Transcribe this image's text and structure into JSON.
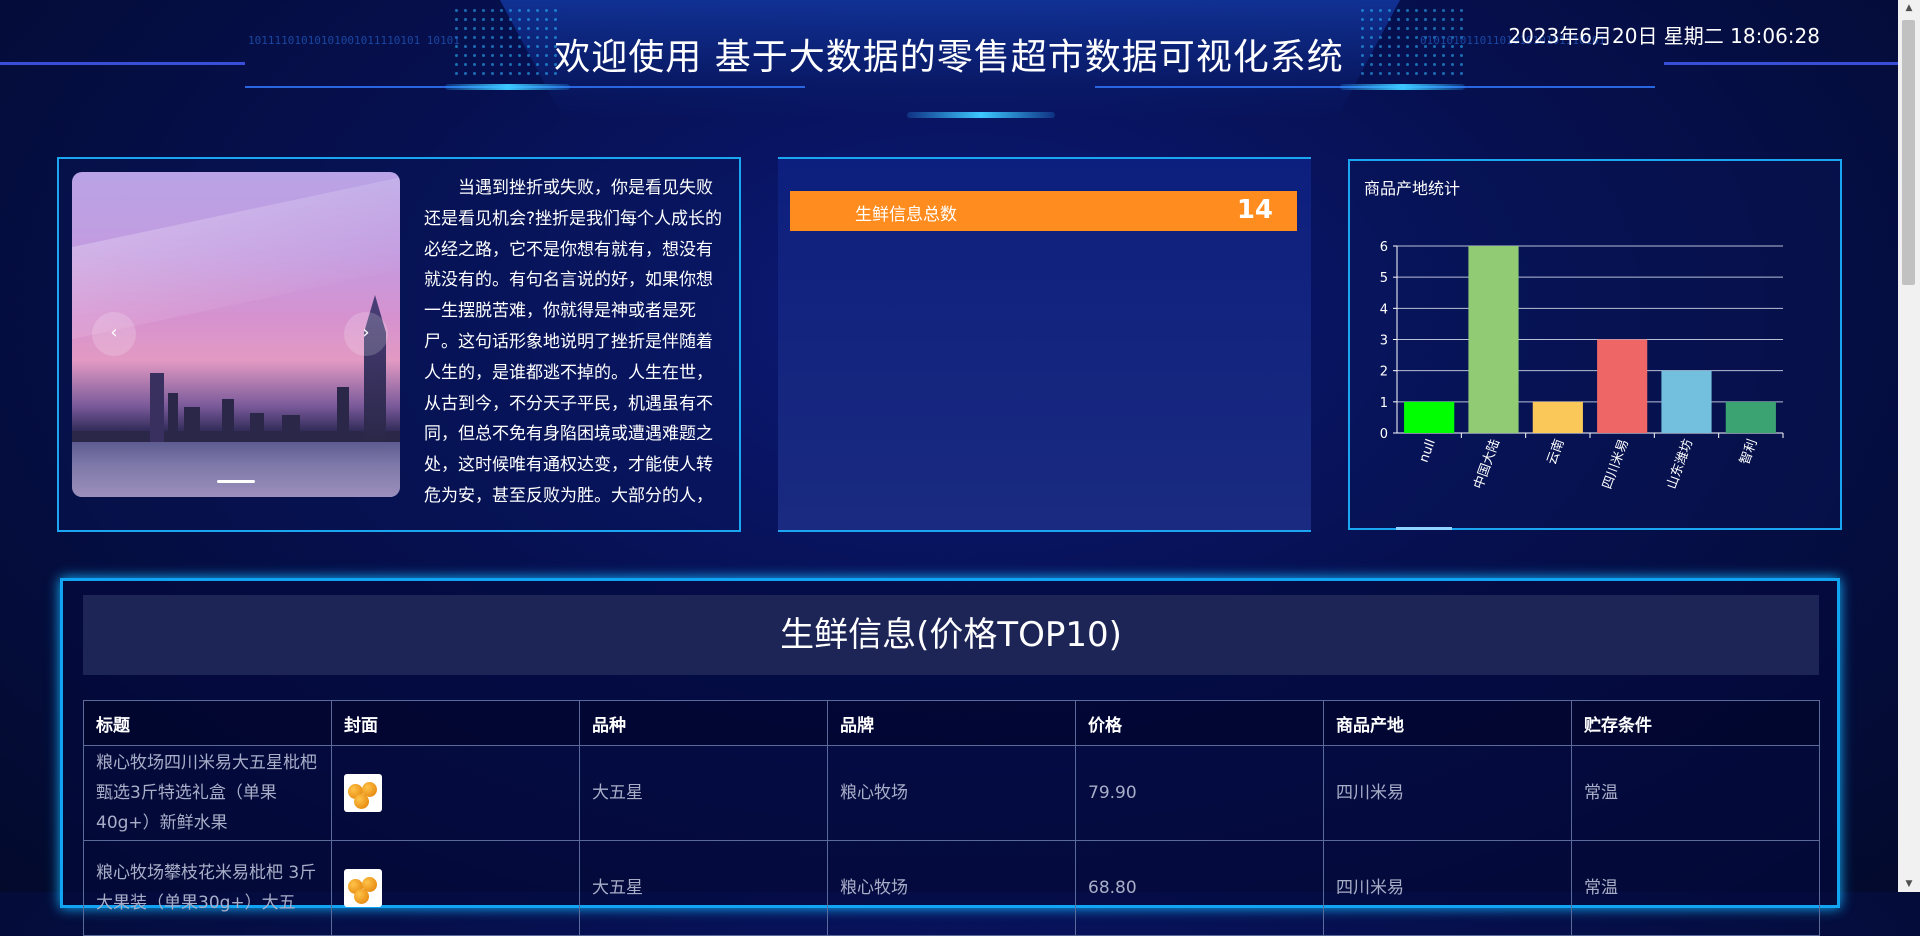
{
  "header": {
    "title": "欢迎使用 基于大数据的零售超市数据可视化系统",
    "datetime": "2023年6月20日 星期二 18:06:28",
    "binary_left": "10111101010101001011110101 10101",
    "binary_right": "0101010110110101010101110101"
  },
  "intro": {
    "text": "当遇到挫折或失败，你是看见失败还是看见机会?挫折是我们每个人成长的必经之路，它不是你想有就有，想没有就没有的。有句名言说的好，如果你想一生摆脱苦难，你就得是神或者是死尸。这句话形象地说明了挫折是伴随着人生的，是谁都逃不掉的。人生在世，从古到今，不分天子平民，机遇虽有不同，但总不免有身陷困境或遭遇难题之处，这时候唯有通权达变，才能使人转危为安，甚至反败为胜。大部分的人，",
    "prev_icon": "‹",
    "next_icon": "›"
  },
  "stat": {
    "label": "生鲜信息总数",
    "value": "14"
  },
  "chart_data": {
    "type": "bar",
    "title": "商品产地统计",
    "categories": [
      "null",
      "中国大陆",
      "云南",
      "四川米易",
      "山东潍坊",
      "智利"
    ],
    "values": [
      1,
      6,
      1,
      3,
      2,
      1
    ],
    "colors": [
      "#00ff00",
      "#91cc75",
      "#fac858",
      "#ee6666",
      "#73c0de",
      "#3ba272"
    ],
    "ylim": [
      0,
      6
    ],
    "yticks": [
      "0",
      "1",
      "2",
      "3",
      "4",
      "5",
      "6"
    ],
    "grid": true
  },
  "table": {
    "title": "生鲜信息(价格TOP10)",
    "columns": [
      "标题",
      "封面",
      "品种",
      "品牌",
      "价格",
      "商品产地",
      "贮存条件"
    ],
    "rows": [
      {
        "title": "粮心牧场四川米易大五星枇杷 甄选3斤特选礼盒（单果40g+）新鲜水果",
        "cover_icon": "loquat-thumbnail",
        "variety": "大五星",
        "brand": "粮心牧场",
        "price": "79.90",
        "origin": "四川米易",
        "storage": "常温"
      },
      {
        "title": "粮心牧场攀枝花米易枇杷 3斤大果装（单果30g+）大五",
        "cover_icon": "loquat-thumbnail",
        "variety": "大五星",
        "brand": "粮心牧场",
        "price": "68.80",
        "origin": "四川米易",
        "storage": "常温"
      }
    ]
  }
}
